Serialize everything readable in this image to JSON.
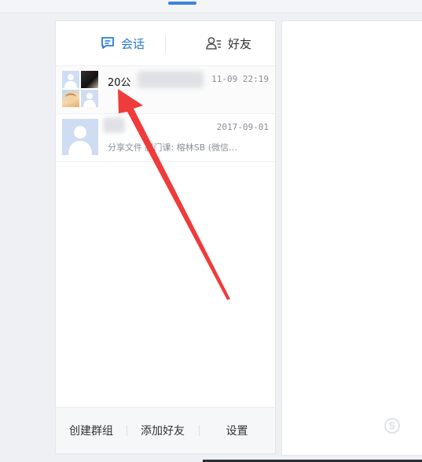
{
  "colors": {
    "accent": "#2b7cd3",
    "arrow": "#ef3b3b",
    "text_primary": "#111111",
    "text_secondary": "#8a8f96"
  },
  "tabs": [
    {
      "label": "会话",
      "icon": "chat-bubble-icon",
      "active": true
    },
    {
      "label": "好友",
      "icon": "contacts-icon",
      "active": false
    }
  ],
  "chats": [
    {
      "name": "20公",
      "time": "11-09 22:19",
      "preview": "",
      "avatar": "group-avatar"
    },
    {
      "name": "",
      "time": "2017-09-01",
      "preview": "分享文件 腾门课: 榕林SB (微信…",
      "avatar": "default-user-avatar"
    }
  ],
  "bottom": {
    "create_group": "创建群组",
    "add_friend": "添加好友",
    "settings": "设置"
  }
}
